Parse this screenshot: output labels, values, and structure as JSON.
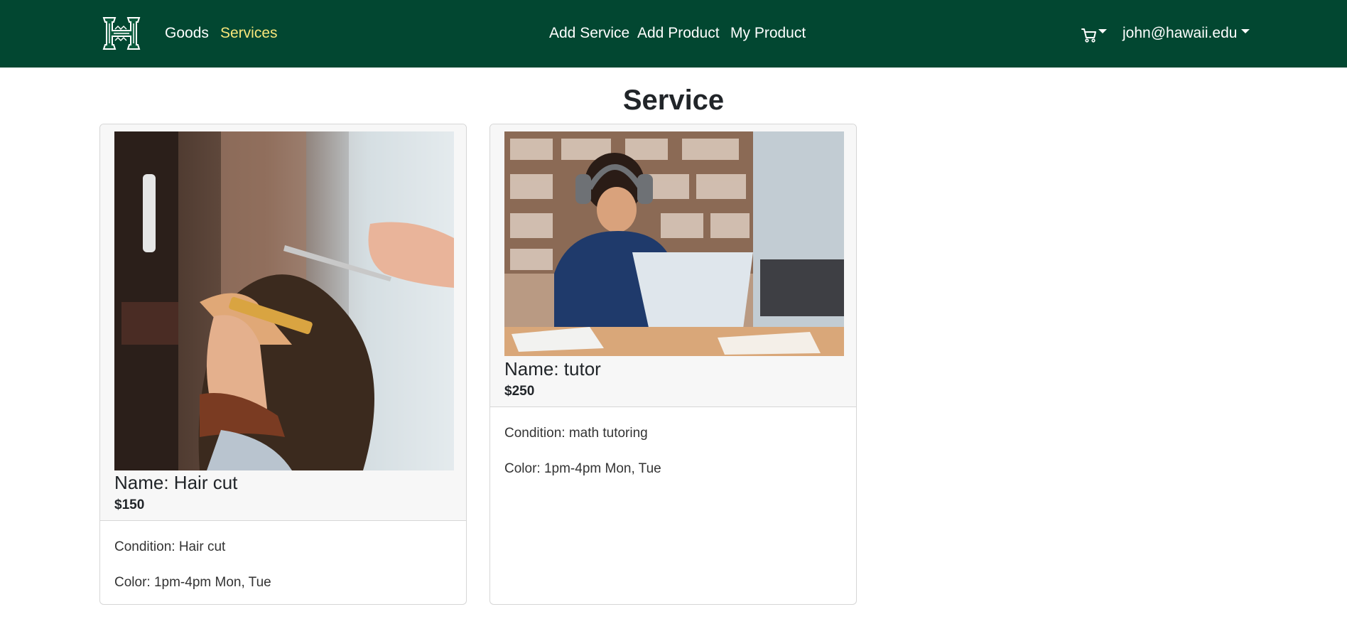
{
  "navbar": {
    "brand_icon": "uh-logo-icon",
    "links": [
      {
        "label": "Goods",
        "active": false
      },
      {
        "label": "Services",
        "active": true
      }
    ],
    "center_links": [
      {
        "label": "Add Service"
      },
      {
        "label": "Add Product"
      },
      {
        "label": "My Product"
      }
    ],
    "cart_icon": "cart-icon",
    "user": {
      "label": "john@hawaii.edu"
    },
    "colors": {
      "background": "#024731",
      "active_link": "#f8e67a",
      "link": "#ffffff"
    }
  },
  "page": {
    "title": "Service"
  },
  "cards": [
    {
      "image_icon": "haircut-photo",
      "name": "Name: Hair cut",
      "price": "$150",
      "condition": "Condition: Hair cut",
      "color": "Color: 1pm-4pm Mon, Tue"
    },
    {
      "image_icon": "tutor-photo",
      "name": "Name: tutor",
      "price": "$250",
      "condition": "Condition: math tutoring",
      "color": "Color: 1pm-4pm Mon, Tue"
    }
  ]
}
